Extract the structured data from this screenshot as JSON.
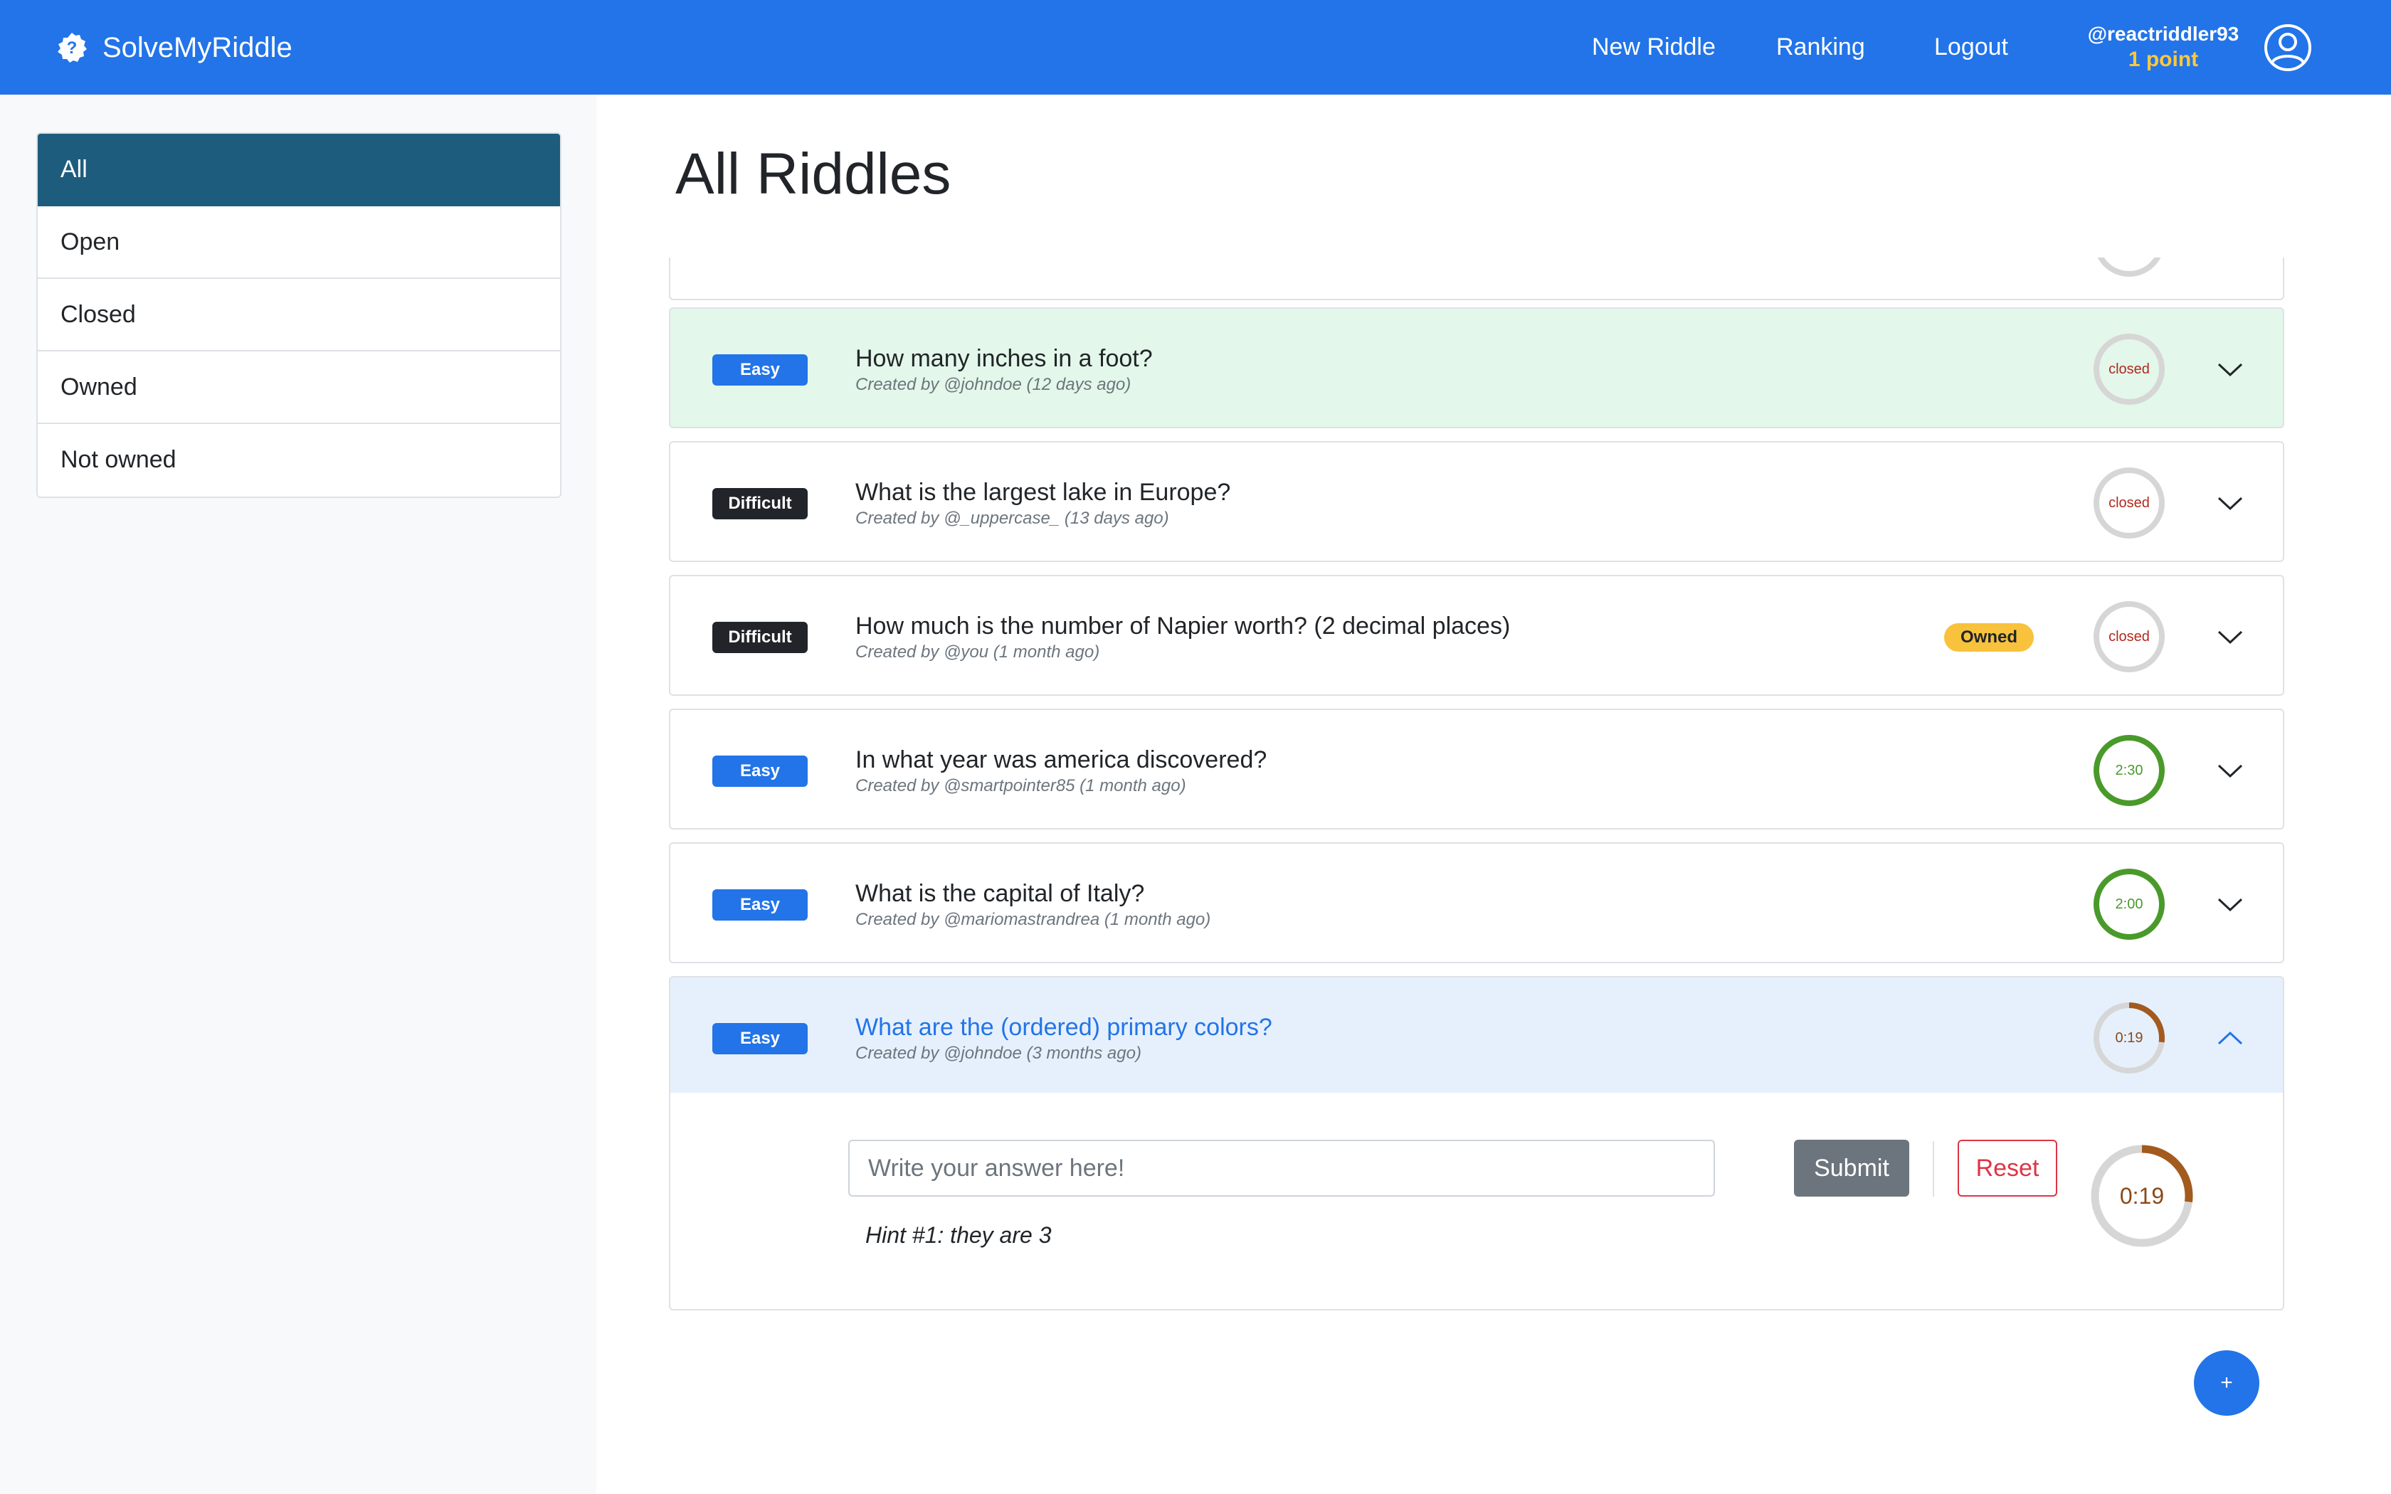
{
  "app": {
    "brand": "SolveMyRiddle"
  },
  "nav": {
    "new_riddle": "New Riddle",
    "ranking": "Ranking",
    "logout": "Logout"
  },
  "user": {
    "handle": "@reactriddler93",
    "points": "1 point"
  },
  "sidebar": {
    "filters": [
      {
        "label": "All",
        "active": true
      },
      {
        "label": "Open",
        "active": false
      },
      {
        "label": "Closed",
        "active": false
      },
      {
        "label": "Owned",
        "active": false
      },
      {
        "label": "Not owned",
        "active": false
      }
    ]
  },
  "main": {
    "title": "All Riddles"
  },
  "riddles": [
    {
      "difficulty": "Easy",
      "question": "How many inches in a foot?",
      "meta": "Created by @johndoe (12 days ago)",
      "owned": false,
      "status": "closed",
      "timer": "closed",
      "timer_fraction": 0,
      "highlight": "success",
      "expanded": false
    },
    {
      "difficulty": "Difficult",
      "question": "What is the largest lake in Europe?",
      "meta": "Created by @_uppercase_ (13 days ago)",
      "owned": false,
      "status": "closed",
      "timer": "closed",
      "timer_fraction": 0,
      "highlight": "none",
      "expanded": false
    },
    {
      "difficulty": "Difficult",
      "question": "How much is the number of Napier worth? (2 decimal places)",
      "meta": "Created by @you (1 month ago)",
      "owned": true,
      "owned_label": "Owned",
      "status": "closed",
      "timer": "closed",
      "timer_fraction": 0,
      "highlight": "none",
      "expanded": false
    },
    {
      "difficulty": "Easy",
      "question": "In what year was america discovered?",
      "meta": "Created by @smartpointer85 (1 month ago)",
      "owned": false,
      "status": "open",
      "timer": "2:30",
      "timer_fraction": 1,
      "highlight": "none",
      "expanded": false
    },
    {
      "difficulty": "Easy",
      "question": "What is the capital of Italy?",
      "meta": "Created by @mariomastrandrea (1 month ago)",
      "owned": false,
      "status": "open",
      "timer": "2:00",
      "timer_fraction": 1,
      "highlight": "none",
      "expanded": false
    },
    {
      "difficulty": "Easy",
      "question": "What are the (ordered) primary colors?",
      "meta": "Created by @johndoe (3 months ago)",
      "owned": false,
      "status": "open",
      "timer": "0:19",
      "timer_fraction": 0.27,
      "highlight": "active",
      "expanded": true
    }
  ],
  "answer_form": {
    "placeholder": "Write your answer here!",
    "value": "",
    "submit_label": "Submit",
    "reset_label": "Reset",
    "hint": "Hint #1: they are 3",
    "timer": "0:19",
    "timer_fraction": 0.27
  },
  "fab": {
    "label": "+"
  },
  "colors": {
    "primary": "#2274e8",
    "sidebar_active": "#1e5c7e",
    "timer_open": "#4a9a2b",
    "timer_low": "#a35a1e",
    "timer_closed_text": "#b02a1e",
    "owned_badge": "#f8c23c",
    "success_bg": "#e3f7ea"
  }
}
